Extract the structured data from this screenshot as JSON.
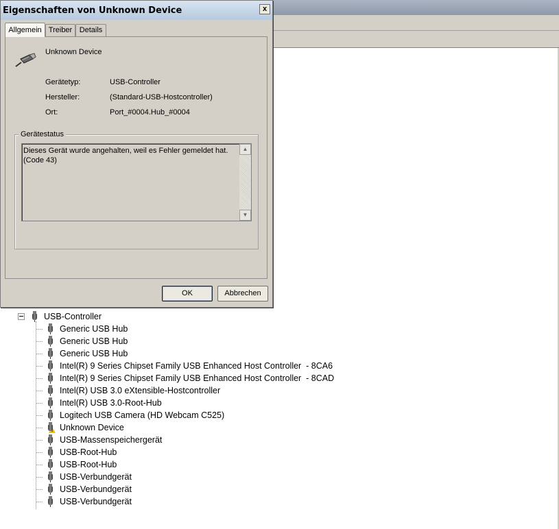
{
  "dialog": {
    "title": "Eigenschaften von Unknown Device",
    "close_label": "x",
    "tabs": [
      {
        "label": "Allgemein"
      },
      {
        "label": "Treiber"
      },
      {
        "label": "Details"
      }
    ],
    "device_name": "Unknown Device",
    "properties": [
      {
        "label": "Gerätetyp:",
        "value": "USB-Controller"
      },
      {
        "label": "Hersteller:",
        "value": "(Standard-USB-Hostcontroller)"
      },
      {
        "label": "Ort:",
        "value": "Port_#0004.Hub_#0004"
      }
    ],
    "status_group_title": "Gerätestatus",
    "status_line1": "Dieses Gerät wurde angehalten, weil es Fehler gemeldet hat.",
    "status_line2": "(Code 43)",
    "ok_label": "OK",
    "cancel_label": "Abbrechen"
  },
  "tree": {
    "root_label": "USB-Controller",
    "items": [
      {
        "label": "Generic USB Hub"
      },
      {
        "label": "Generic USB Hub"
      },
      {
        "label": "Generic USB Hub"
      },
      {
        "label": "Intel(R) 9 Series Chipset Family USB Enhanced Host Controller  - 8CA6"
      },
      {
        "label": "Intel(R) 9 Series Chipset Family USB Enhanced Host Controller  - 8CAD"
      },
      {
        "label": "Intel(R) USB 3.0 eXtensible-Hostcontroller"
      },
      {
        "label": "Intel(R) USB 3.0-Root-Hub"
      },
      {
        "label": "Logitech USB Camera (HD Webcam C525)"
      },
      {
        "label": "Unknown Device"
      },
      {
        "label": "USB-Massenspeichergerät"
      },
      {
        "label": "USB-Root-Hub"
      },
      {
        "label": "USB-Root-Hub"
      },
      {
        "label": "USB-Verbundgerät"
      },
      {
        "label": "USB-Verbundgerät"
      },
      {
        "label": "USB-Verbundgerät"
      }
    ]
  }
}
